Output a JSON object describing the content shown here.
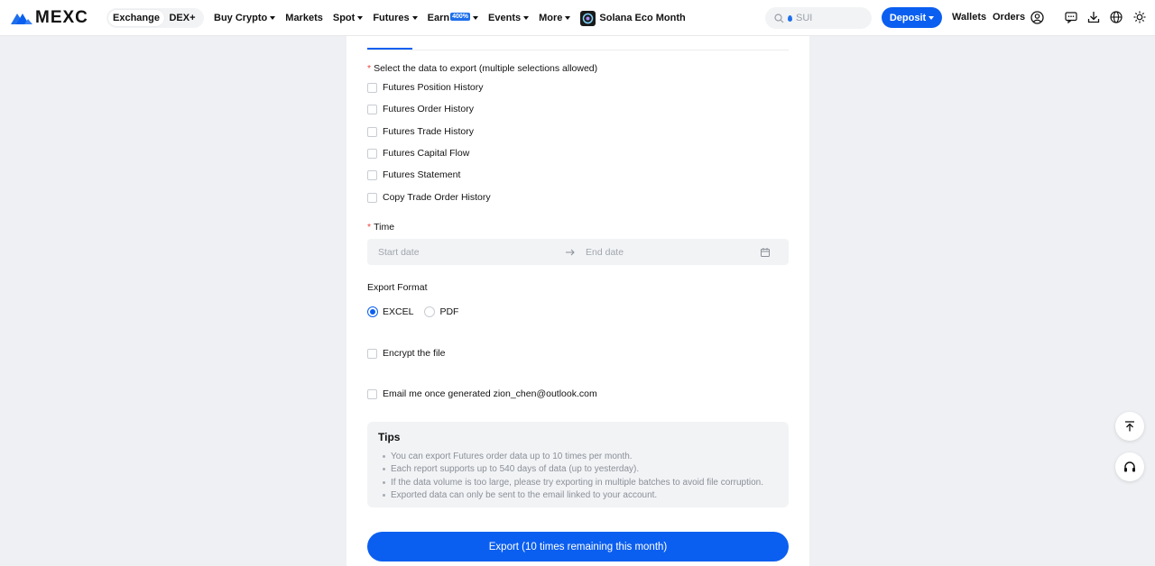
{
  "brand": {
    "name": "MEXC",
    "logo_icon": "mexc-logo-icon",
    "color": "#0b5ff0"
  },
  "nav": {
    "segment": {
      "active": "Exchange",
      "other": "DEX+"
    },
    "menu": [
      {
        "label": "Buy Crypto",
        "dropdown": true
      },
      {
        "label": "Markets",
        "dropdown": false
      },
      {
        "label": "Spot",
        "dropdown": true
      },
      {
        "label": "Futures",
        "dropdown": true
      },
      {
        "label": "Earn",
        "badge": "400%",
        "dropdown": true
      },
      {
        "label": "Events",
        "dropdown": true
      },
      {
        "label": "More",
        "dropdown": true
      }
    ],
    "promo": "Solana Eco Month",
    "search_placeholder": "SUI",
    "deposit": "Deposit",
    "wallets": "Wallets",
    "orders": "Orders",
    "icons": [
      "user-icon",
      "message-icon",
      "download-icon",
      "globe-icon",
      "theme-icon"
    ]
  },
  "form": {
    "select_label": "Select the data to export (multiple selections allowed)",
    "options": [
      "Futures Position History",
      "Futures Order History",
      "Futures Trade History",
      "Futures Capital Flow",
      "Futures Statement",
      "Copy Trade Order History"
    ],
    "time_label": "Time",
    "start_placeholder": "Start date",
    "end_placeholder": "End date",
    "format_label": "Export Format",
    "formats": [
      "EXCEL",
      "PDF"
    ],
    "selected_format": "EXCEL",
    "encrypt_label": "Encrypt the file",
    "email_label": "Email me once generated zion_chen@outlook.com",
    "tips_title": "Tips",
    "tips": [
      "You can export Futures order data up to 10 times per month.",
      "Each report supports up to 540 days of data (up to yesterday).",
      "If the data volume is too large, please try exporting in multiple batches to avoid file corruption.",
      "Exported data can only be sent to the email linked to your account."
    ],
    "export_button": "Export (10 times remaining this month)"
  },
  "floating": [
    "back-to-top-icon",
    "support-headset-icon"
  ],
  "colors": {
    "accent": "#0b5ff0",
    "required": "#f0463c",
    "panel_bg": "#ffffff",
    "page_bg": "#eef0f3"
  }
}
